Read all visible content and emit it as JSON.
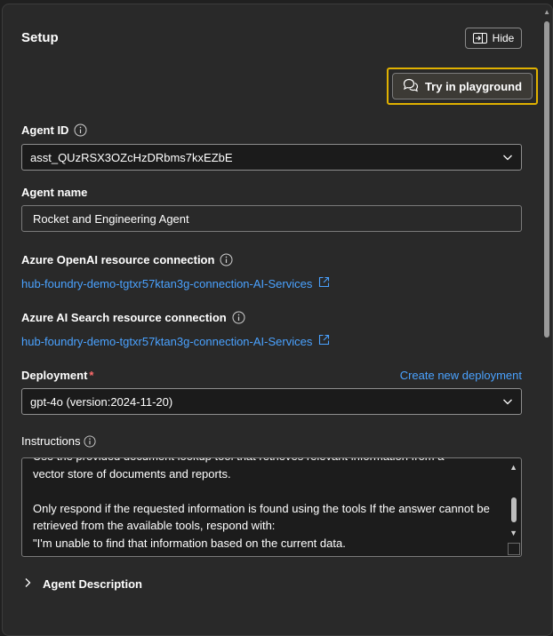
{
  "setup": {
    "title": "Setup",
    "hide_label": "Hide",
    "playground_label": "Try in playground"
  },
  "agent_id": {
    "label": "Agent ID",
    "value": "asst_QUzRSX3OZcHzDRbms7kxEZbE"
  },
  "agent_name": {
    "label": "Agent name",
    "value": "Rocket and Engineering Agent"
  },
  "openai_connection": {
    "label": "Azure OpenAI resource connection",
    "link": "hub-foundry-demo-tgtxr57ktan3g-connection-AI-Services"
  },
  "search_connection": {
    "label": "Azure AI Search resource connection",
    "link": "hub-foundry-demo-tgtxr57ktan3g-connection-AI-Services"
  },
  "deployment": {
    "label": "Deployment",
    "required_mark": "*",
    "create_link": "Create new deployment",
    "value": "gpt-4o (version:2024-11-20)"
  },
  "instructions": {
    "label": "Instructions",
    "lines": [
      "Use the provided document lookup tool that retrieves relevant information from a",
      "vector store of documents and reports.",
      "Only respond if the requested information is found using the tools If the answer cannot be retrieved from the available tools, respond with:",
      "\"I'm unable to find that information based on the current data."
    ]
  },
  "agent_description": {
    "label": "Agent Description"
  },
  "icons": {
    "hide": "panel-collapse-icon",
    "playground": "chat-bubbles-icon",
    "info": "info-icon",
    "chevron": "chevron-down-icon",
    "external": "external-link-icon",
    "expander": "chevron-right-icon"
  },
  "colors": {
    "background": "#292929",
    "accent_link": "#4aa2ff",
    "highlight_border": "#e0b100",
    "required": "#ff6b6b"
  }
}
